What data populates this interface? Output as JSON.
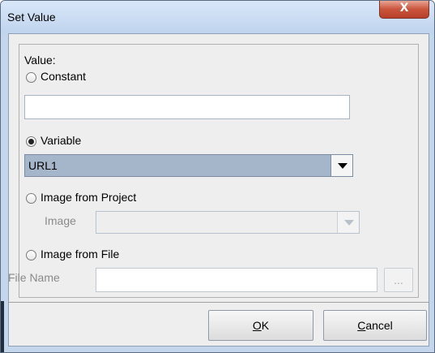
{
  "window": {
    "title": "Set Value",
    "close_label": "X"
  },
  "value_label": "Value:",
  "options": {
    "constant": {
      "label": "Constant",
      "selected": false,
      "input_value": ""
    },
    "variable": {
      "label": "Variable",
      "selected": true,
      "dropdown_value": "URL1"
    },
    "image_from_project": {
      "label": "Image from Project",
      "selected": false,
      "field_label": "Image",
      "dropdown_value": ""
    },
    "image_from_file": {
      "label": "Image from File",
      "selected": false,
      "field_label": "File Name",
      "input_value": "",
      "browse_label": "..."
    }
  },
  "buttons": {
    "ok_mnemonic": "O",
    "ok_rest": "K",
    "cancel_mnemonic": "C",
    "cancel_rest": "ancel"
  },
  "colors": {
    "selected_combo": "#a6b6ca",
    "titlebar": "#c4d6ec",
    "close": "#c9533b"
  }
}
